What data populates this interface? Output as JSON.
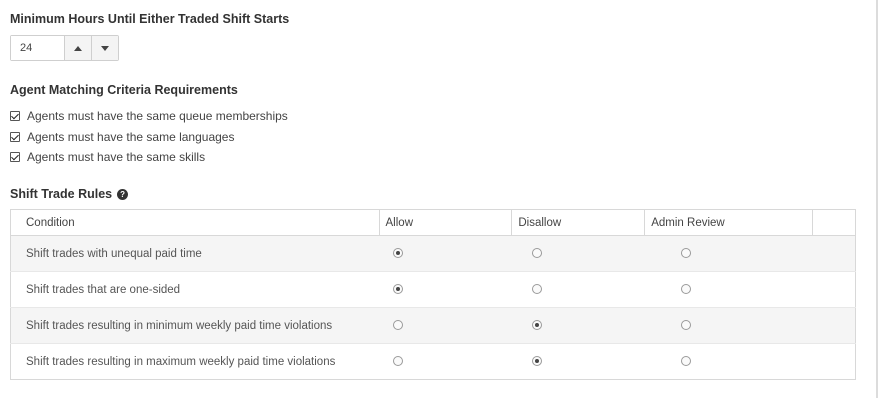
{
  "min_hours": {
    "title": "Minimum Hours Until Either Traded Shift Starts",
    "value": "24",
    "increment_icon": "triangle-up-icon",
    "decrement_icon": "triangle-down-icon"
  },
  "matching": {
    "title": "Agent Matching Criteria Requirements",
    "criteria": [
      {
        "label": "Agents must have the same queue memberships",
        "checked": true
      },
      {
        "label": "Agents must have the same languages",
        "checked": true
      },
      {
        "label": "Agents must have the same skills",
        "checked": true
      }
    ]
  },
  "rules": {
    "title": "Shift Trade Rules",
    "help_icon": "question-circle-icon",
    "columns": [
      "Condition",
      "Allow",
      "Disallow",
      "Admin Review"
    ],
    "rows": [
      {
        "condition": "Shift trades with unequal paid time",
        "selected": "Allow"
      },
      {
        "condition": "Shift trades that are one-sided",
        "selected": "Allow"
      },
      {
        "condition": "Shift trades resulting in minimum weekly paid time violations",
        "selected": "Disallow"
      },
      {
        "condition": "Shift trades resulting in maximum weekly paid time violations",
        "selected": "Disallow"
      }
    ]
  }
}
